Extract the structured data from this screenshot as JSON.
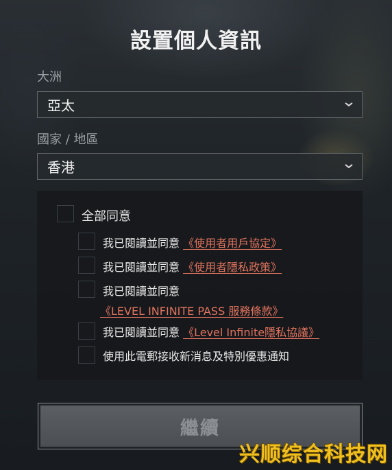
{
  "page": {
    "title": "設置個人資訊"
  },
  "region": {
    "label": "大洲",
    "value": "亞太"
  },
  "country": {
    "label": "國家 / 地區",
    "value": "香港"
  },
  "consent": {
    "all_label": "全部同意",
    "items": [
      {
        "text": "我已閱讀並同意 ",
        "link": "《使用者用戶協定》"
      },
      {
        "text": "我已閱讀並同意 ",
        "link": "《使用者隱私政策》"
      },
      {
        "text": "我已閱讀並同意",
        "link": "《LEVEL INFINITE PASS 服務條款》"
      },
      {
        "text": "我已閱讀並同意 ",
        "link": "《Level Infinite隱私協議》"
      },
      {
        "text": "使用此電郵接收新消息及特別優惠通知",
        "link": ""
      }
    ]
  },
  "continue_button": {
    "label": "繼續"
  },
  "watermark": {
    "text": "兴顺综合科技网"
  },
  "colors": {
    "link": "#e0745e",
    "watermark": "#f0c020"
  }
}
